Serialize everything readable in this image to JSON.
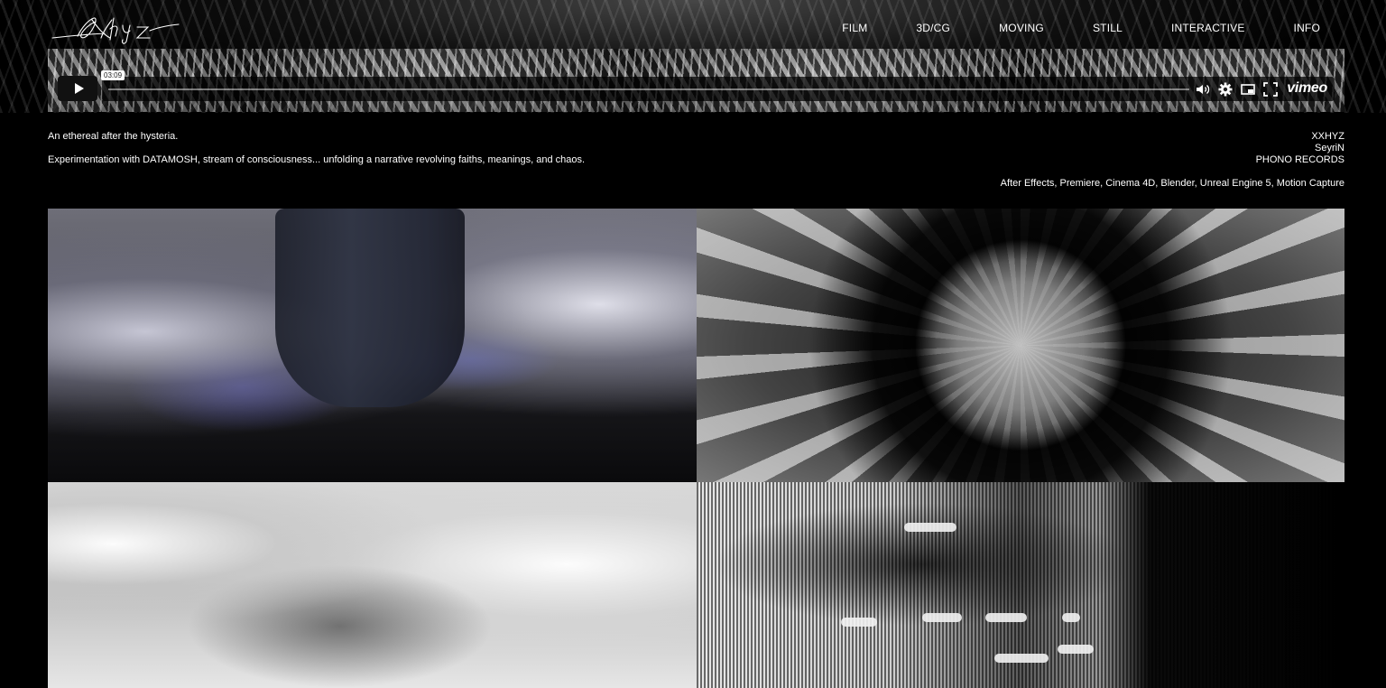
{
  "site": {
    "logo_text": "XXhyz"
  },
  "nav": {
    "items": [
      "FILM",
      "3D/CG",
      "MOVING",
      "STILL",
      "INTERACTIVE",
      "INFO"
    ]
  },
  "player": {
    "time": "03:09",
    "progress_fraction": 0.0,
    "brand": "vimeo",
    "icons": [
      "play-icon",
      "volume-icon",
      "settings-gear-icon",
      "picture-in-picture-icon",
      "fullscreen-icon"
    ]
  },
  "description": {
    "tagline": "An ethereal after the hysteria.",
    "body": "Experimentation with DATAMOSH, stream of consciousness... unfolding a narrative revolving faiths, meanings, and chaos."
  },
  "credits": {
    "lines": [
      "XXHYZ",
      "SeyriN",
      "PHONO RECORDS"
    ],
    "tools": "After Effects, Premiere, Cinema 4D, Blender, Unreal Engine 5, Motion Capture"
  },
  "colors": {
    "background": "#000000",
    "text": "#ffffff"
  }
}
